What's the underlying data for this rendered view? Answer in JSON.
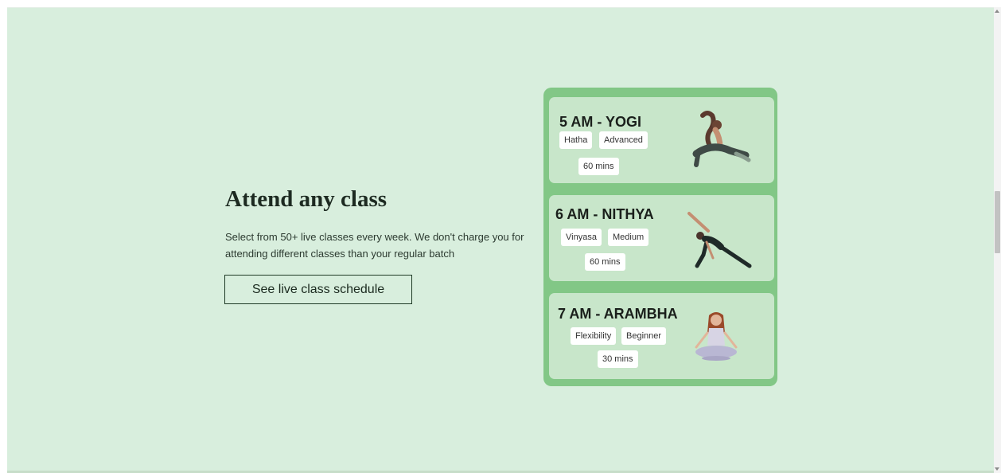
{
  "section": {
    "heading": "Attend any class",
    "description": "Select from 50+ live classes every week. We don't charge you for attending different classes than your regular batch",
    "cta_label": "See live class schedule"
  },
  "classes": [
    {
      "title": "5 AM - YOGI",
      "tags": [
        "Hatha",
        "Advanced"
      ],
      "duration": "60 mins",
      "image": "yoga-pose-king-pigeon"
    },
    {
      "title": "6 AM - NITHYA",
      "tags": [
        "Vinyasa",
        "Medium"
      ],
      "duration": "60 mins",
      "image": "yoga-pose-extended-side-angle"
    },
    {
      "title": "7 AM - ARAMBHA",
      "tags": [
        "Flexibility",
        "Beginner"
      ],
      "duration": "30 mins",
      "image": "yoga-pose-lotus-meditation"
    }
  ],
  "colors": {
    "page_background": "#d8eedd",
    "panel": "#82c786",
    "card": "#c8e6ca",
    "tag": "#ffffff",
    "text_dark": "#1a1f1b"
  }
}
